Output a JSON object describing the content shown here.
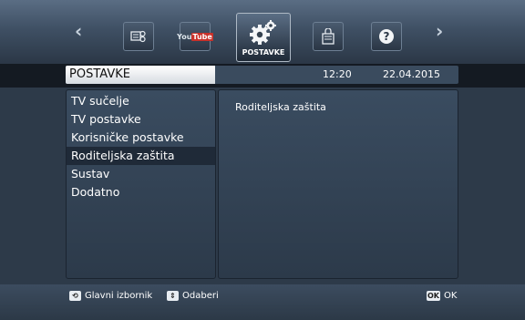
{
  "nav": {
    "prev_arrow": "‹",
    "next_arrow": "›",
    "tiles": [
      {
        "icon": "media-icon"
      },
      {
        "icon": "youtube-icon",
        "text_a": "You",
        "text_b": "Tube"
      },
      {
        "icon": "settings-gears-icon",
        "label": "POSTAVKE"
      },
      {
        "icon": "shopping-bag-icon"
      },
      {
        "icon": "help-icon",
        "text": "?"
      }
    ]
  },
  "header": {
    "title": "POSTAVKE",
    "time": "12:20",
    "date": "22.04.2015"
  },
  "menu": {
    "items": [
      {
        "label": "TV sučelje"
      },
      {
        "label": "TV postavke"
      },
      {
        "label": "Korisničke postavke"
      },
      {
        "label": "Roditeljska zaštita"
      },
      {
        "label": "Sustav"
      },
      {
        "label": "Dodatno"
      }
    ],
    "selected_index": 3
  },
  "detail": {
    "heading": "Roditeljska zaštita"
  },
  "footer": {
    "back_label": "Glavni izbornik",
    "select_label": "Odaberi",
    "ok_key": "OK",
    "ok_label": "OK"
  },
  "colors": {
    "background": "#2d3a49",
    "selected_row": "#1f2a38"
  }
}
